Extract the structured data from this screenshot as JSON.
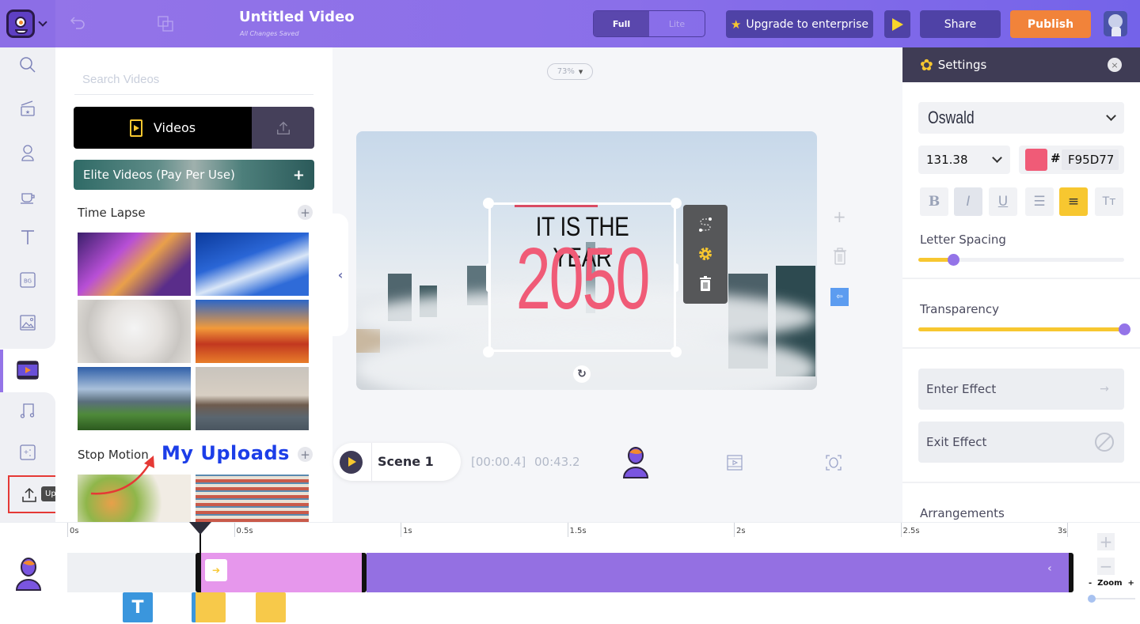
{
  "topbar": {
    "title": "Untitled Video",
    "subtitle": "All Changes Saved",
    "mode_full": "Full",
    "mode_lite": "Lite",
    "upgrade_label": "Upgrade to enterprise",
    "share_label": "Share",
    "publish_label": "Publish"
  },
  "rail": {
    "items": [
      "search-icon",
      "templates-icon",
      "characters-icon",
      "props-icon",
      "text-icon",
      "background-icon",
      "images-icon",
      "videos-icon",
      "music-icon",
      "effects-icon",
      "uploads-icon"
    ],
    "bg_label": "BG",
    "active": "videos",
    "tooltip": "Uploads"
  },
  "library": {
    "search_placeholder": "Search Videos",
    "tab_videos": "Videos",
    "elite_label": "Elite Videos (Pay Per Use)",
    "elite_plus": "+",
    "sections": [
      {
        "title": "Time Lapse",
        "plus": "+"
      },
      {
        "title": "Stop Motion",
        "plus": "+"
      }
    ],
    "annotation": "My Uploads"
  },
  "canvas": {
    "zoom": "73%",
    "text_line1": "IT IS THE YEAR",
    "text_line2": "2050",
    "add_symbol": "+",
    "rotate_symbol": "↻"
  },
  "scene": {
    "name": "Scene 1",
    "current_time": "[00:00.4]",
    "total_time": "00:43.2"
  },
  "settings": {
    "title": "Settings",
    "close_symbol": "×",
    "font": "Oswald",
    "font_size": "131.38",
    "color_hash": "#",
    "color_hex": "F95D77",
    "color_value": "#F95D77",
    "format_buttons": [
      {
        "name": "bold",
        "glyph": "B",
        "state": "off"
      },
      {
        "name": "italic",
        "glyph": "I",
        "state": "pressed"
      },
      {
        "name": "underline",
        "glyph": "U",
        "state": "off"
      },
      {
        "name": "list",
        "glyph": "☰",
        "state": "off"
      },
      {
        "name": "align-center",
        "glyph": "≡",
        "state": "active"
      },
      {
        "name": "text-case",
        "glyph": "Tт",
        "state": "off"
      }
    ],
    "letter_spacing_label": "Letter Spacing",
    "letter_spacing_fraction": 0.17,
    "transparency_label": "Transparency",
    "transparency_fraction": 1.0,
    "enter_effect_label": "Enter Effect",
    "enter_effect_icon": "→",
    "exit_effect_label": "Exit Effect",
    "arrangements_label": "Arrangements"
  },
  "timeline": {
    "ticks": [
      "0s",
      "0.5s",
      "1s",
      "1.5s",
      "2s",
      "2.5s",
      "3s"
    ],
    "enter_icon": "➔",
    "exit_icon": "‹",
    "text_chip": "T",
    "zoom_label": "-  Zoom  +",
    "zoom_plus": "+",
    "zoom_minus": "−",
    "zoom_fraction": 0.0
  },
  "colors": {
    "accent_purple": "#9474e8",
    "publish_orange": "#f1833a",
    "highlight_yellow": "#f7c730",
    "text_pink": "#f05b77",
    "annotation_blue": "#1c3ee8"
  }
}
